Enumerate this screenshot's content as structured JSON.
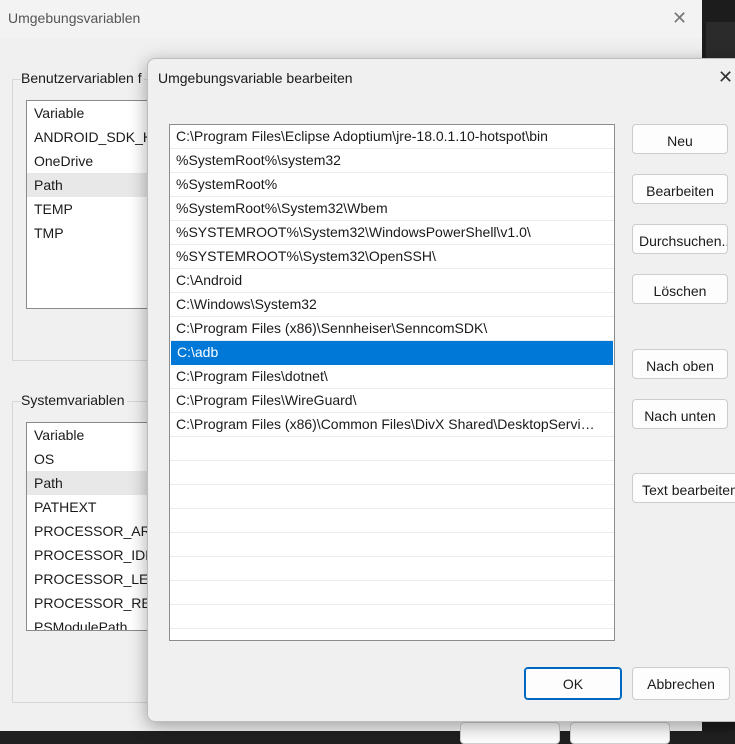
{
  "background_window": {
    "title": "Umgebungsvariablen",
    "user_group_label": "Benutzervariablen f",
    "user_list": {
      "header": "Variable",
      "items": [
        "ANDROID_SDK_H",
        "OneDrive",
        "Path",
        "TEMP",
        "TMP"
      ],
      "selected": "Path"
    },
    "system_group_label": "Systemvariablen",
    "system_list": {
      "header": "Variable",
      "items": [
        "OS",
        "Path",
        "PATHEXT",
        "PROCESSOR_ARC",
        "PROCESSOR_IDEI",
        "PROCESSOR_LEVI",
        "PROCESSOR_REV",
        "PSModulePath"
      ],
      "selected": "Path"
    }
  },
  "dialog": {
    "title": "Umgebungsvariable bearbeiten",
    "close_glyph": "✕",
    "paths": [
      "C:\\Program Files\\Eclipse Adoptium\\jre-18.0.1.10-hotspot\\bin",
      "%SystemRoot%\\system32",
      "%SystemRoot%",
      "%SystemRoot%\\System32\\Wbem",
      "%SYSTEMROOT%\\System32\\WindowsPowerShell\\v1.0\\",
      "%SYSTEMROOT%\\System32\\OpenSSH\\",
      "C:\\Android",
      "C:\\Windows\\System32",
      "C:\\Program Files (x86)\\Sennheiser\\SenncomSDK\\",
      "C:\\adb",
      "C:\\Program Files\\dotnet\\",
      "C:\\Program Files\\WireGuard\\",
      "C:\\Program Files (x86)\\Common Files\\DivX Shared\\DesktopServi…"
    ],
    "selected_index": 9,
    "buttons": {
      "new": "Neu",
      "edit": "Bearbeiten",
      "browse": "Durchsuchen...",
      "delete": "Löschen",
      "move_up": "Nach oben",
      "move_down": "Nach unten",
      "edit_text": "Text bearbeiten",
      "ok": "OK",
      "cancel": "Abbrechen"
    }
  },
  "colors": {
    "selection": "#0078d7",
    "dialog_bg": "#f0f0f0",
    "ok_border": "#0067c0"
  }
}
